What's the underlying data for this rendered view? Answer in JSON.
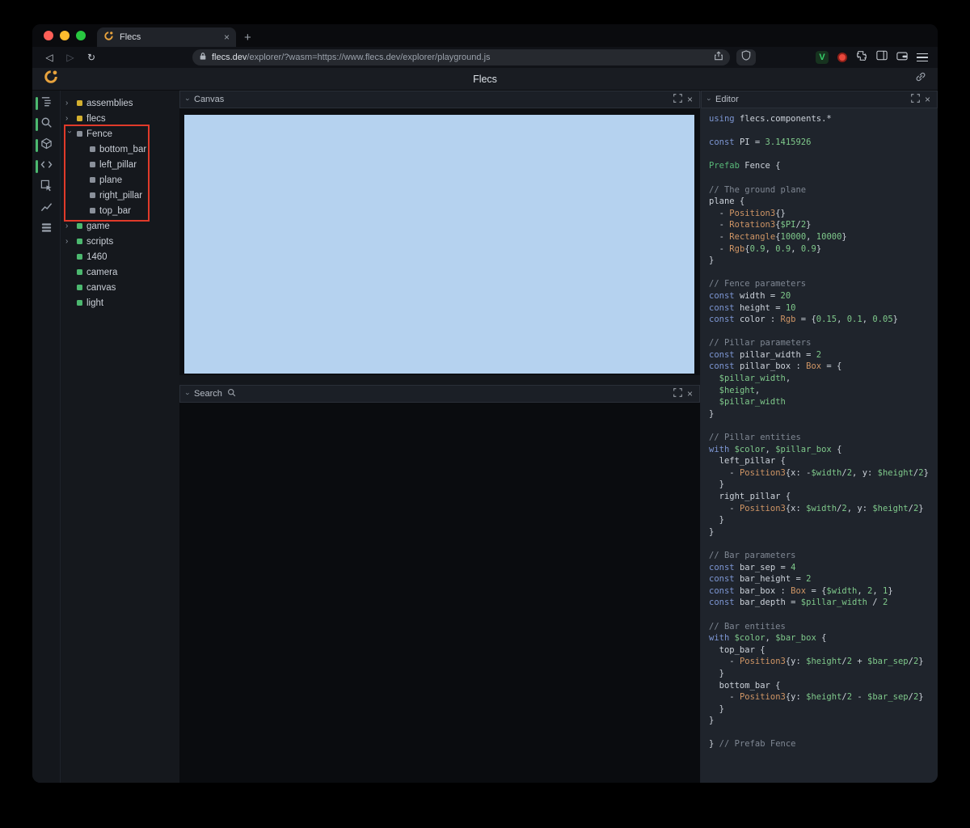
{
  "browser": {
    "tab_title": "Flecs",
    "url_host": "flecs.dev",
    "url_path": "/explorer/?wasm=https://www.flecs.dev/explorer/playground.js"
  },
  "header": {
    "title": "Flecs"
  },
  "panels": {
    "canvas": "Canvas",
    "search": "Search",
    "editor": "Editor"
  },
  "rail": {
    "items": [
      {
        "name": "hierarchy-icon",
        "active": true
      },
      {
        "name": "search-icon",
        "active": true
      },
      {
        "name": "cube-icon",
        "active": true
      },
      {
        "name": "code-icon",
        "active": true
      },
      {
        "name": "inspect-icon",
        "active": false
      },
      {
        "name": "chart-icon",
        "active": false
      },
      {
        "name": "stats-icon",
        "active": false
      }
    ]
  },
  "tree": {
    "items": [
      {
        "label": "assemblies",
        "dot": "yellow",
        "arrow": "collapsed",
        "indent": 0
      },
      {
        "label": "flecs",
        "dot": "yellow",
        "arrow": "collapsed",
        "indent": 0
      },
      {
        "label": "Fence",
        "dot": "grey",
        "arrow": "expanded",
        "indent": 0
      },
      {
        "label": "bottom_bar",
        "dot": "grey",
        "arrow": "none",
        "indent": 1
      },
      {
        "label": "left_pillar",
        "dot": "grey",
        "arrow": "none",
        "indent": 1
      },
      {
        "label": "plane",
        "dot": "grey",
        "arrow": "none",
        "indent": 1
      },
      {
        "label": "right_pillar",
        "dot": "grey",
        "arrow": "none",
        "indent": 1
      },
      {
        "label": "top_bar",
        "dot": "grey",
        "arrow": "none",
        "indent": 1
      },
      {
        "label": "game",
        "dot": "green",
        "arrow": "collapsed",
        "indent": 0
      },
      {
        "label": "scripts",
        "dot": "green",
        "arrow": "collapsed",
        "indent": 0
      },
      {
        "label": "1460",
        "dot": "green",
        "arrow": "none",
        "indent": 0
      },
      {
        "label": "camera",
        "dot": "green",
        "arrow": "none",
        "indent": 0
      },
      {
        "label": "canvas",
        "dot": "green",
        "arrow": "none",
        "indent": 0
      },
      {
        "label": "light",
        "dot": "green",
        "arrow": "none",
        "indent": 0
      }
    ]
  },
  "colors": {
    "accent_green": "#4cb86f",
    "accent_yellow": "#d4b02f",
    "entity_grey": "#8a909a",
    "canvas_blue": "#b5d2ef",
    "annotation_red": "#e03a2a",
    "code_plain": "#ccd2da",
    "code_keyword": "#7d96d3",
    "code_type": "#cf9565",
    "code_number": "#7fc98b",
    "code_var": "#7fc98b",
    "code_comment": "#7f8793",
    "code_prefab": "#58b878"
  },
  "editor_code": {
    "lines": [
      [
        [
          "k",
          "using "
        ],
        [
          "p",
          "flecs.components.*"
        ]
      ],
      [],
      [
        [
          "k",
          "const "
        ],
        [
          "p",
          "PI = "
        ],
        [
          "n",
          "3.1415926"
        ]
      ],
      [],
      [
        [
          "g",
          "Prefab "
        ],
        [
          "p",
          "Fence {"
        ]
      ],
      [],
      [
        [
          "c",
          "// The ground plane"
        ]
      ],
      [
        [
          "p",
          "plane {"
        ]
      ],
      [
        [
          "p",
          "  - "
        ],
        [
          "t",
          "Position3"
        ],
        [
          "p",
          "{}"
        ]
      ],
      [
        [
          "p",
          "  - "
        ],
        [
          "t",
          "Rotation3"
        ],
        [
          "p",
          "{"
        ],
        [
          "v",
          "$PI"
        ],
        [
          "p",
          "/"
        ],
        [
          "n",
          "2"
        ],
        [
          "p",
          "}"
        ]
      ],
      [
        [
          "p",
          "  - "
        ],
        [
          "t",
          "Rectangle"
        ],
        [
          "p",
          "{"
        ],
        [
          "n",
          "10000"
        ],
        [
          "p",
          ", "
        ],
        [
          "n",
          "10000"
        ],
        [
          "p",
          "}"
        ]
      ],
      [
        [
          "p",
          "  - "
        ],
        [
          "t",
          "Rgb"
        ],
        [
          "p",
          "{"
        ],
        [
          "n",
          "0.9"
        ],
        [
          "p",
          ", "
        ],
        [
          "n",
          "0.9"
        ],
        [
          "p",
          ", "
        ],
        [
          "n",
          "0.9"
        ],
        [
          "p",
          "}"
        ]
      ],
      [
        [
          "p",
          "}"
        ]
      ],
      [],
      [
        [
          "c",
          "// Fence parameters"
        ]
      ],
      [
        [
          "k",
          "const "
        ],
        [
          "p",
          "width = "
        ],
        [
          "n",
          "20"
        ]
      ],
      [
        [
          "k",
          "const "
        ],
        [
          "p",
          "height = "
        ],
        [
          "n",
          "10"
        ]
      ],
      [
        [
          "k",
          "const "
        ],
        [
          "p",
          "color : "
        ],
        [
          "t",
          "Rgb"
        ],
        [
          "p",
          " = {"
        ],
        [
          "n",
          "0.15"
        ],
        [
          "p",
          ", "
        ],
        [
          "n",
          "0.1"
        ],
        [
          "p",
          ", "
        ],
        [
          "n",
          "0.05"
        ],
        [
          "p",
          "}"
        ]
      ],
      [],
      [
        [
          "c",
          "// Pillar parameters"
        ]
      ],
      [
        [
          "k",
          "const "
        ],
        [
          "p",
          "pillar_width = "
        ],
        [
          "n",
          "2"
        ]
      ],
      [
        [
          "k",
          "const "
        ],
        [
          "p",
          "pillar_box : "
        ],
        [
          "t",
          "Box"
        ],
        [
          "p",
          " = {"
        ]
      ],
      [
        [
          "p",
          "  "
        ],
        [
          "v",
          "$pillar_width"
        ],
        [
          "p",
          ","
        ]
      ],
      [
        [
          "p",
          "  "
        ],
        [
          "v",
          "$height"
        ],
        [
          "p",
          ","
        ]
      ],
      [
        [
          "p",
          "  "
        ],
        [
          "v",
          "$pillar_width"
        ]
      ],
      [
        [
          "p",
          "}"
        ]
      ],
      [],
      [
        [
          "c",
          "// Pillar entities"
        ]
      ],
      [
        [
          "k",
          "with "
        ],
        [
          "v",
          "$color"
        ],
        [
          "p",
          ", "
        ],
        [
          "v",
          "$pillar_box"
        ],
        [
          "p",
          " {"
        ]
      ],
      [
        [
          "p",
          "  left_pillar {"
        ]
      ],
      [
        [
          "p",
          "    - "
        ],
        [
          "t",
          "Position3"
        ],
        [
          "p",
          "{x: -"
        ],
        [
          "v",
          "$width"
        ],
        [
          "p",
          "/"
        ],
        [
          "n",
          "2"
        ],
        [
          "p",
          ", y: "
        ],
        [
          "v",
          "$height"
        ],
        [
          "p",
          "/"
        ],
        [
          "n",
          "2"
        ],
        [
          "p",
          "}"
        ]
      ],
      [
        [
          "p",
          "  }"
        ]
      ],
      [
        [
          "p",
          "  right_pillar {"
        ]
      ],
      [
        [
          "p",
          "    - "
        ],
        [
          "t",
          "Position3"
        ],
        [
          "p",
          "{x: "
        ],
        [
          "v",
          "$width"
        ],
        [
          "p",
          "/"
        ],
        [
          "n",
          "2"
        ],
        [
          "p",
          ", y: "
        ],
        [
          "v",
          "$height"
        ],
        [
          "p",
          "/"
        ],
        [
          "n",
          "2"
        ],
        [
          "p",
          "}"
        ]
      ],
      [
        [
          "p",
          "  }"
        ]
      ],
      [
        [
          "p",
          "}"
        ]
      ],
      [],
      [
        [
          "c",
          "// Bar parameters"
        ]
      ],
      [
        [
          "k",
          "const "
        ],
        [
          "p",
          "bar_sep = "
        ],
        [
          "n",
          "4"
        ]
      ],
      [
        [
          "k",
          "const "
        ],
        [
          "p",
          "bar_height = "
        ],
        [
          "n",
          "2"
        ]
      ],
      [
        [
          "k",
          "const "
        ],
        [
          "p",
          "bar_box : "
        ],
        [
          "t",
          "Box"
        ],
        [
          "p",
          " = {"
        ],
        [
          "v",
          "$width"
        ],
        [
          "p",
          ", "
        ],
        [
          "n",
          "2"
        ],
        [
          "p",
          ", "
        ],
        [
          "n",
          "1"
        ],
        [
          "p",
          "}"
        ]
      ],
      [
        [
          "k",
          "const "
        ],
        [
          "p",
          "bar_depth = "
        ],
        [
          "v",
          "$pillar_width"
        ],
        [
          "p",
          " / "
        ],
        [
          "n",
          "2"
        ]
      ],
      [],
      [
        [
          "c",
          "// Bar entities"
        ]
      ],
      [
        [
          "k",
          "with "
        ],
        [
          "v",
          "$color"
        ],
        [
          "p",
          ", "
        ],
        [
          "v",
          "$bar_box"
        ],
        [
          "p",
          " {"
        ]
      ],
      [
        [
          "p",
          "  top_bar {"
        ]
      ],
      [
        [
          "p",
          "    - "
        ],
        [
          "t",
          "Position3"
        ],
        [
          "p",
          "{y: "
        ],
        [
          "v",
          "$height"
        ],
        [
          "p",
          "/"
        ],
        [
          "n",
          "2"
        ],
        [
          "p",
          " + "
        ],
        [
          "v",
          "$bar_sep"
        ],
        [
          "p",
          "/"
        ],
        [
          "n",
          "2"
        ],
        [
          "p",
          "}"
        ]
      ],
      [
        [
          "p",
          "  }"
        ]
      ],
      [
        [
          "p",
          "  bottom_bar {"
        ]
      ],
      [
        [
          "p",
          "    - "
        ],
        [
          "t",
          "Position3"
        ],
        [
          "p",
          "{y: "
        ],
        [
          "v",
          "$height"
        ],
        [
          "p",
          "/"
        ],
        [
          "n",
          "2"
        ],
        [
          "p",
          " - "
        ],
        [
          "v",
          "$bar_sep"
        ],
        [
          "p",
          "/"
        ],
        [
          "n",
          "2"
        ],
        [
          "p",
          "}"
        ]
      ],
      [
        [
          "p",
          "  }"
        ]
      ],
      [
        [
          "p",
          "}"
        ]
      ],
      [],
      [
        [
          "p",
          "} "
        ],
        [
          "c",
          "// Prefab Fence"
        ]
      ]
    ]
  }
}
